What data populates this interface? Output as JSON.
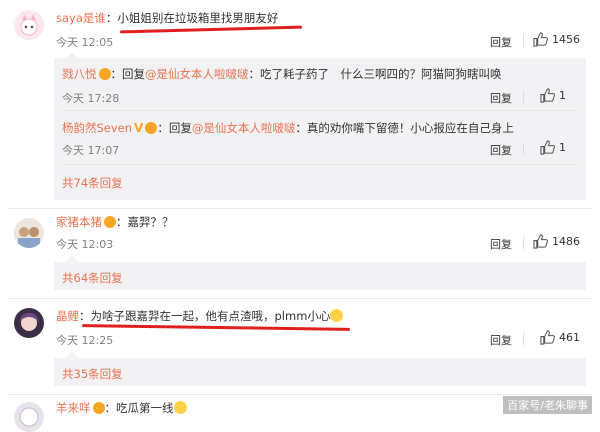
{
  "comments": [
    {
      "user": "saya是谁",
      "text": "小姐姐别在垃圾箱里找男朋友好",
      "time": "今天 12:05",
      "reply_label": "回复",
      "likes": "1456",
      "replies": [
        {
          "user": "戮八悦",
          "mid": "：回复",
          "mention": "@是仙女本人啦啵啵",
          "text": "：吃了耗子药了　什么三啊四的？阿猫阿狗瞎叫唤",
          "time": "今天 17:28",
          "reply_label": "回复",
          "likes": "1"
        },
        {
          "user": "杨韵然Seven",
          "mid": "：回复",
          "mention": "@是仙女本人啦啵啵",
          "text": "：真的劝你嘴下留德！小心报应在自己身上",
          "time": "今天 17:07",
          "reply_label": "回复",
          "likes": "1"
        }
      ],
      "more": "共74条回复"
    },
    {
      "user": "家猪本猪",
      "text": "：嘉羿？？",
      "time": "今天 12:03",
      "reply_label": "回复",
      "likes": "1486",
      "more": "共64条回复"
    },
    {
      "user": "晶鲤",
      "text": "为啥子跟嘉羿在一起，他有点渣哦，plmm小心",
      "time": "今天 12:25",
      "reply_label": "回复",
      "likes": "461",
      "more": "共35条回复"
    },
    {
      "user": "羊来咩",
      "text": "：吃瓜第一线"
    }
  ],
  "watermark": "百家号/老朱聊事",
  "colors": {
    "accent": "#eb7350",
    "underline": "#e0201e"
  }
}
